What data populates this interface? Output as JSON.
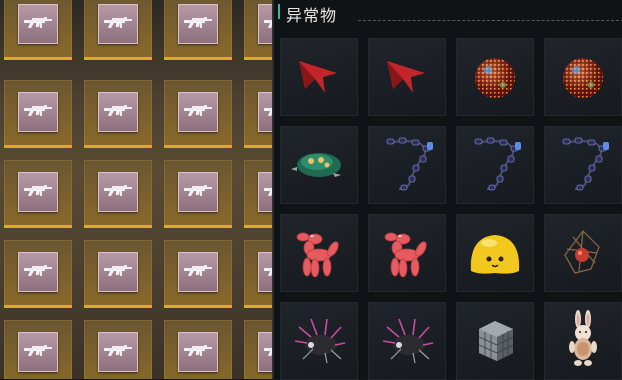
{
  "panel": {
    "title": "异常物",
    "link_icon": "link-icon"
  },
  "left_grid": {
    "item_icon": "rifle-icon",
    "accent_color": "#e3a72d"
  },
  "items": [
    {
      "icon": "red-arrow-icon"
    },
    {
      "icon": "red-arrow-icon"
    },
    {
      "icon": "disco-ball-icon"
    },
    {
      "icon": "disco-ball-icon"
    },
    {
      "icon": "green-turtle-shell-icon"
    },
    {
      "icon": "beaded-chain-icon"
    },
    {
      "icon": "beaded-chain-icon"
    },
    {
      "icon": "beaded-chain-icon"
    },
    {
      "icon": "balloon-dog-icon"
    },
    {
      "icon": "balloon-dog-icon"
    },
    {
      "icon": "yellow-blob-icon"
    },
    {
      "icon": "cage-lantern-icon"
    },
    {
      "icon": "spiky-shell-icon"
    },
    {
      "icon": "spiky-shell-icon"
    },
    {
      "icon": "metal-cube-icon"
    },
    {
      "icon": "plush-bunny-icon"
    }
  ]
}
